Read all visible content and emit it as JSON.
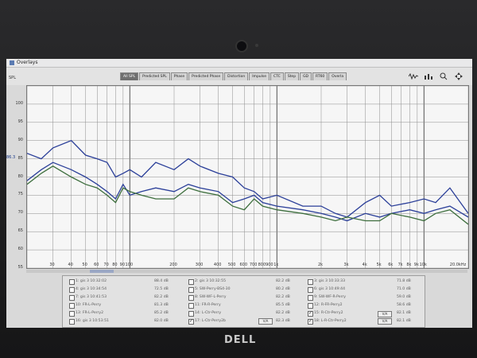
{
  "window": {
    "title": "Overlays"
  },
  "toolbar": {
    "tabs": [
      "All SPL",
      "Predicted SPL",
      "Phase",
      "Predicted Phase",
      "Distortion",
      "Impulse",
      "CTC",
      "Step",
      "GD",
      "RT60",
      "Overla"
    ],
    "icons": [
      "waveform-icon",
      "eq-icon",
      "zoom-in-icon",
      "move-icon"
    ]
  },
  "plot": {
    "y_unit": "SPL",
    "y_ticks": [
      "100",
      "95",
      "90",
      "85",
      "80",
      "75",
      "70",
      "65",
      "60",
      "55"
    ],
    "y_ref_marker": "86.3",
    "x_ticks": [
      "30",
      "40",
      "50",
      "60",
      "70",
      "80",
      "90",
      "100",
      "200",
      "300",
      "400",
      "500",
      "600",
      "700",
      "800",
      "900",
      "1k",
      "2k",
      "3k",
      "4k",
      "5k",
      "6k",
      "7k",
      "8k",
      "9k",
      "10k",
      "20.0kHz"
    ],
    "colors": {
      "blue": "#2b3f99",
      "green": "#3d6e3d",
      "grid": "#8c8c8c",
      "bg": "#f6f6f6"
    }
  },
  "chart_data": {
    "type": "line",
    "xscale": "log",
    "xlim": [
      20,
      20000
    ],
    "ylim": [
      55,
      105
    ],
    "series": [
      {
        "color": "#2b3f99",
        "x": [
          20,
          25,
          30,
          40,
          50,
          60,
          70,
          80,
          90,
          100,
          120,
          150,
          200,
          250,
          300,
          400,
          500,
          600,
          700,
          800,
          1000,
          1500,
          2000,
          2500,
          3000,
          4000,
          5000,
          6000,
          8000,
          10000,
          12000,
          15000,
          20000
        ],
        "y": [
          86.5,
          85,
          88,
          90,
          86,
          85,
          84,
          80,
          81,
          82,
          80,
          84,
          82,
          85,
          83,
          81,
          80,
          77,
          76,
          74,
          75,
          72,
          72,
          70,
          69,
          73,
          75,
          72,
          73,
          74,
          73,
          77,
          70
        ]
      },
      {
        "color": "#2b3f99",
        "x": [
          20,
          25,
          30,
          40,
          50,
          60,
          70,
          80,
          90,
          100,
          120,
          150,
          200,
          250,
          300,
          400,
          500,
          600,
          700,
          800,
          1000,
          1500,
          2000,
          2500,
          3000,
          4000,
          5000,
          6000,
          8000,
          10000,
          12000,
          15000,
          20000
        ],
        "y": [
          79,
          82,
          84,
          82,
          80,
          78,
          76,
          74,
          78,
          75,
          76,
          77,
          76,
          78,
          77,
          76,
          73,
          74,
          75,
          73,
          72,
          71,
          70,
          69,
          68,
          70,
          69,
          70,
          71,
          70,
          71,
          72,
          69
        ]
      },
      {
        "color": "#3d6e3d",
        "x": [
          20,
          25,
          30,
          40,
          50,
          60,
          70,
          80,
          90,
          100,
          120,
          150,
          200,
          250,
          300,
          400,
          500,
          600,
          700,
          800,
          1000,
          1500,
          2000,
          2500,
          3000,
          4000,
          5000,
          6000,
          8000,
          10000,
          12000,
          15000,
          20000
        ],
        "y": [
          78,
          81,
          83,
          80,
          78,
          77,
          75,
          73,
          77,
          76,
          75,
          74,
          74,
          77,
          76,
          75,
          72,
          71,
          74,
          72,
          71,
          70,
          69,
          68,
          69,
          68,
          68,
          70,
          69,
          68,
          70,
          71,
          67
        ]
      }
    ]
  },
  "legend": {
    "rows": [
      [
        {
          "name": "1: gis 3 10:32:02",
          "value": "88.4 dB",
          "checked": false
        },
        {
          "name": "2: gis 3 10:32:55",
          "value": "82.2 dB",
          "checked": false
        },
        {
          "name": "3: gis 3 10:33:33",
          "value": "71.8 dB",
          "checked": false
        }
      ],
      [
        {
          "name": "4: gis 3 10:34:54",
          "value": "72.5 dB",
          "checked": false
        },
        {
          "name": "5: SW-Perry-BS4-30",
          "value": "80.2 dB",
          "checked": false
        },
        {
          "name": "6: gis 3 10:49:44",
          "value": "71.0 dB",
          "checked": false
        }
      ],
      [
        {
          "name": "7: gis 3 10:41:53",
          "value": "82.2 dB",
          "checked": false
        },
        {
          "name": "8: SW-WF-L-Perry",
          "value": "82.2 dB",
          "checked": false
        },
        {
          "name": "9: SW-WF-R-Perry",
          "value": "59.0 dB",
          "checked": false
        }
      ],
      [
        {
          "name": "10: FR-L-Perry",
          "value": "81.3 dB",
          "checked": false
        },
        {
          "name": "11: FR-R-Perry",
          "value": "85.5 dB",
          "checked": false
        },
        {
          "name": "12: R-FR-Perry2",
          "value": "58.6 dB",
          "checked": false
        }
      ],
      [
        {
          "name": "13: FR-L-Perry2",
          "value": "85.2 dB",
          "checked": false
        },
        {
          "name": "14: L-Ctr-Perry",
          "value": "82.2 dB",
          "checked": false
        },
        {
          "name": "15: R-Ctr-Perry2",
          "value": "82.1 dB",
          "checked": true
        }
      ],
      [
        {
          "name": "16: gis 3 10:53:51",
          "value": "82.0 dB",
          "checked": false
        },
        {
          "name": "17: L-Ctr-Perry2b",
          "value": "82.3 dB",
          "checked": true
        },
        {
          "name": "18: L-R-Ctr-Perry2",
          "value": "82.1 dB",
          "checked": true
        }
      ]
    ],
    "vol_labels": [
      "V/A",
      "V/A",
      "V/A"
    ]
  },
  "brand": {
    "logo": "DELL"
  }
}
